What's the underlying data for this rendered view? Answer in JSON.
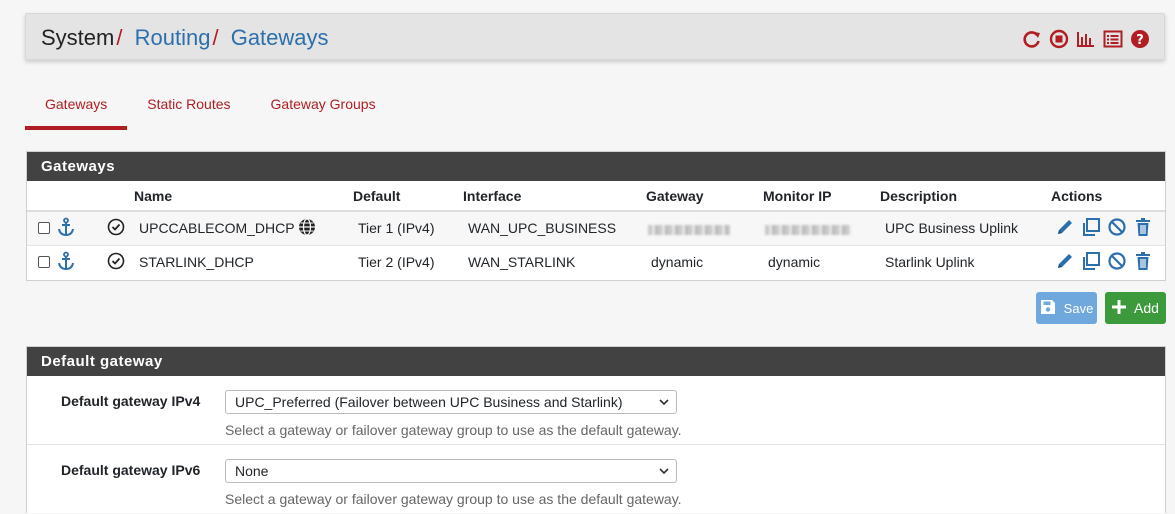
{
  "breadcrumb": {
    "root": "System",
    "sep": "/",
    "level1": "Routing",
    "level2": "Gateways"
  },
  "header_icons": [
    "reload-icon",
    "stop-icon",
    "chart-icon",
    "list-icon",
    "help-icon"
  ],
  "tabs": [
    {
      "label": "Gateways",
      "active": true
    },
    {
      "label": "Static Routes",
      "active": false
    },
    {
      "label": "Gateway Groups",
      "active": false
    }
  ],
  "gateways_panel": {
    "title": "Gateways",
    "columns": {
      "name": "Name",
      "default": "Default",
      "interface": "Interface",
      "gateway": "Gateway",
      "monitor_ip": "Monitor IP",
      "description": "Description",
      "actions": "Actions"
    },
    "rows": [
      {
        "name": "UPCCABLECOM_DHCP",
        "default": "Tier 1 (IPv4)",
        "interface": "WAN_UPC_BUSINESS",
        "gateway": "",
        "monitor_ip": "",
        "description": "UPC Business Uplink"
      },
      {
        "name": "STARLINK_DHCP",
        "default": "Tier 2 (IPv4)",
        "interface": "WAN_STARLINK",
        "gateway": "dynamic",
        "monitor_ip": "dynamic",
        "description": "Starlink Uplink"
      }
    ]
  },
  "buttons": {
    "save": "Save",
    "add": "Add"
  },
  "default_gateway_panel": {
    "title": "Default gateway",
    "ipv4": {
      "label": "Default gateway IPv4",
      "value": "UPC_Preferred (Failover between UPC Business and Starlink)",
      "help": "Select a gateway or failover gateway group to use as the default gateway."
    },
    "ipv6": {
      "label": "Default gateway IPv6",
      "value": "None",
      "help": "Select a gateway or failover gateway group to use as the default gateway."
    }
  },
  "colors": {
    "accent": "#b01e24",
    "link": "#2c6fad",
    "panel_heading": "#424242",
    "save": "#6fa8dc",
    "add": "#3c9a3c"
  }
}
